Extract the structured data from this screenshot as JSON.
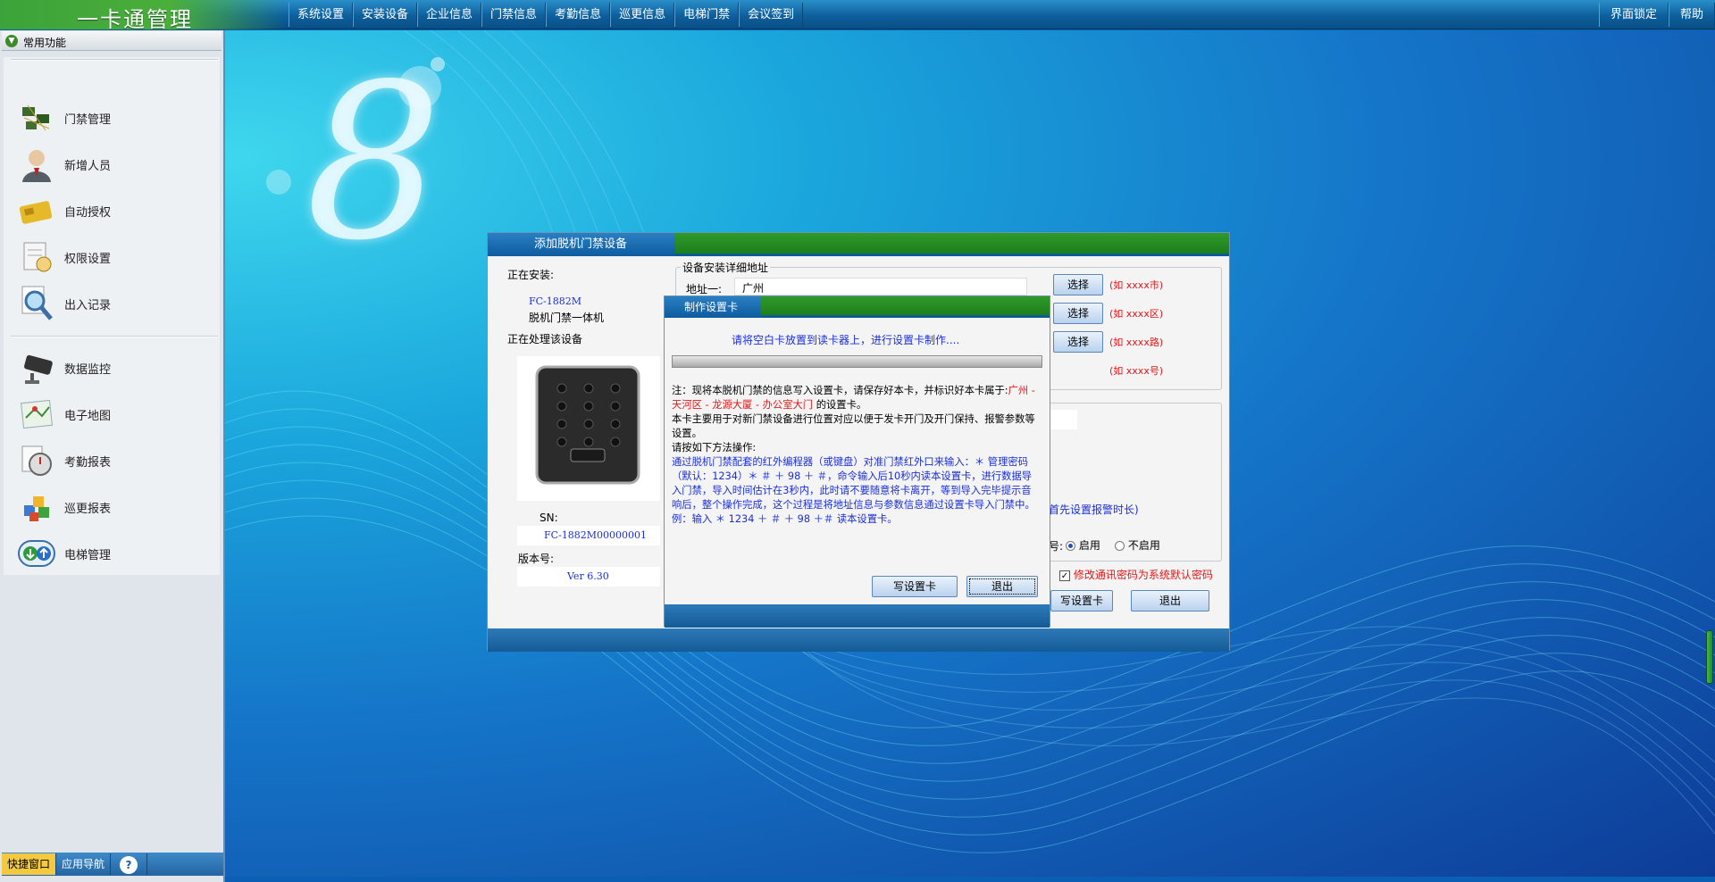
{
  "app": {
    "title": "一卡通管理"
  },
  "menu": {
    "items": [
      "系统设置",
      "安装设备",
      "企业信息",
      "门禁信息",
      "考勤信息",
      "巡更信息",
      "电梯门禁",
      "会议签到"
    ],
    "right": [
      "界面锁定",
      "帮助"
    ]
  },
  "sidebar": {
    "header": "常用功能",
    "items": [
      {
        "label": "门禁管理",
        "icon": "circuit-board-icon"
      },
      {
        "label": "新增人员",
        "icon": "person-icon"
      },
      {
        "label": "自动授权",
        "icon": "card-icon"
      },
      {
        "label": "权限设置",
        "icon": "document-clock-icon"
      },
      {
        "label": "出入记录",
        "icon": "magnifier-document-icon"
      },
      {
        "label": "数据监控",
        "icon": "camera-icon"
      },
      {
        "label": "电子地图",
        "icon": "map-icon"
      },
      {
        "label": "考勤报表",
        "icon": "stopwatch-icon"
      },
      {
        "label": "巡更报表",
        "icon": "blocks-icon"
      },
      {
        "label": "电梯管理",
        "icon": "elevator-icon"
      }
    ],
    "footer_tabs": [
      "快捷窗口",
      "应用导航",
      "?"
    ]
  },
  "background": {
    "logo_digit": "8"
  },
  "add_device_dialog": {
    "title": "添加脱机门禁设备",
    "installing_label": "正在安装:",
    "model": "FC-1882M",
    "model_desc": "脱机门禁一体机",
    "processing_label": "正在处理该设备",
    "sn_label": "SN:",
    "sn_value": "FC-1882M00000001",
    "version_label": "版本号:",
    "version_value": "Ver 6.30",
    "address_group_label": "设备安装详细地址",
    "address_label": "地址一:",
    "address_value": "广州",
    "select_button": "选择",
    "hints": [
      "(如 xxxx市)",
      "(如 xxxx区)",
      "(如 xxxx路)",
      "(如 xxxx号)"
    ],
    "alarm_text": "首先设置报警时长)",
    "radio_fragment": "号:",
    "radio_enable": "启用",
    "radio_disable": "不启用",
    "checkbox_label": "修改通讯密码为系统默认密码",
    "write_button": "写设置卡",
    "exit_button": "退出"
  },
  "make_card_dialog": {
    "title": "制作设置卡",
    "prompt": "请将空白卡放置到读卡器上，进行设置卡制作....",
    "note_prefix": "注：现将本脱机门禁的信息写入设置卡，请保存好本卡，并标识好本卡属于:",
    "note_location": "广州 - 天河区 - 龙源大厦 - 办公室大门",
    "note_suffix": "的设置卡。",
    "note_line2": "本卡主要用于对新门禁设备进行位置对应以便于发卡开门及开门保持、报警参数等设置。",
    "note_line3": "请按如下方法操作:",
    "instruction": "通过脱机门禁配套的红外编程器（或键盘）对准门禁红外口来输入：＊ 管理密码（默认：1234）＊ ＃ ＋ 98 ＋ ＃，命令输入后10秒内读本设置卡，进行数据导入门禁，导入时间估计在3秒内，此时请不要随意将卡离开，等到导入完毕提示音响后，整个操作完成，这个过程是将地址信息与参数信息通过设置卡导入门禁中。",
    "example": "例：输入 ＊ 1234 ＋ ＃ ＋ 98 ＋＃ 读本设置卡。",
    "write_button": "写设置卡",
    "exit_button": "退出"
  },
  "colors": {
    "title_green": "#1d7e1c",
    "hint_red": "#e01818",
    "text_blue": "#1a2fd6",
    "active_tab": "#f4c93f"
  }
}
